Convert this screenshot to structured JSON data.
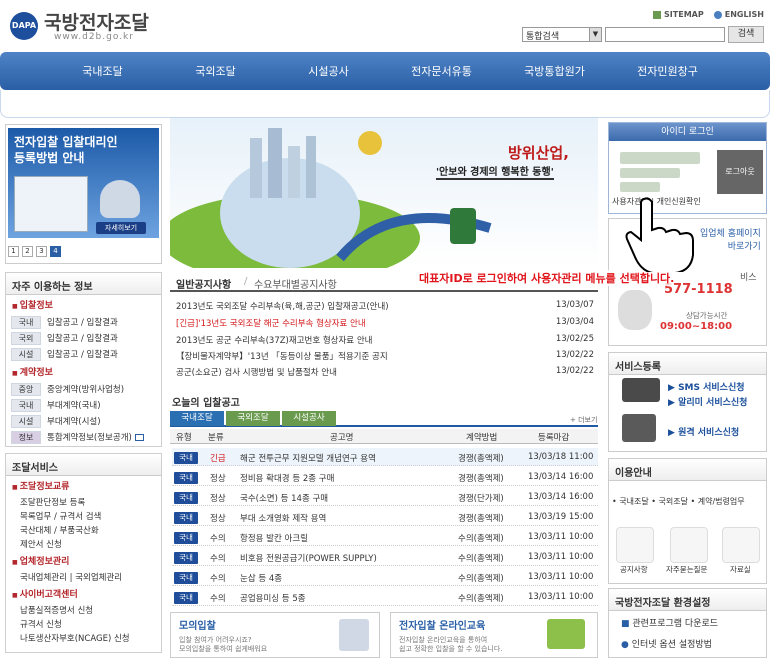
{
  "header": {
    "logo_mark": "DAPA",
    "site_name": "국방전자조달",
    "site_url": "www.d2b.go.kr",
    "sitemap": "SITEMAP",
    "english": "ENGLISH",
    "search_select": "통합검색",
    "search_button": "검색"
  },
  "nav": [
    "국내조달",
    "국외조달",
    "시설공사",
    "전자문서유통",
    "국방통합원가",
    "전자민원창구"
  ],
  "promo": {
    "title_line1": "전자입찰 입찰대리인",
    "title_line2": "등록방법 안내",
    "button": "자세히보기",
    "pages": [
      "1",
      "2",
      "3",
      "4"
    ],
    "active_page": "4"
  },
  "favorites": {
    "title": "자주 이용하는 정보",
    "groups": [
      {
        "name": "입찰정보",
        "rows": [
          {
            "tag": "국내",
            "text": "입찰공고 / 입찰결과"
          },
          {
            "tag": "국외",
            "text": "입찰공고 / 입찰결과"
          },
          {
            "tag": "시설",
            "text": "입찰공고 / 입찰결과"
          }
        ]
      },
      {
        "name": "계약정보",
        "rows": [
          {
            "tag": "중앙",
            "text": "중앙계약(방위사업청)"
          },
          {
            "tag": "국내",
            "text": "부대계약(국내)"
          },
          {
            "tag": "시설",
            "text": "부대계약(시설)"
          },
          {
            "tag": "정보",
            "text": "통합계약정보(정보공개)"
          }
        ]
      }
    ]
  },
  "services": {
    "title": "조달서비스",
    "groups": [
      {
        "name": "조달정보교류",
        "items": [
          "조달판단정보 등록",
          "목록업무 / 규격서 검색",
          "국산대체 / 부품국산화",
          "제안서 신청"
        ]
      },
      {
        "name": "업체정보관리",
        "items": [
          "국내업체관리 | 국외업체관리"
        ]
      },
      {
        "name": "사이버고객센터",
        "items": [
          "납품실적증명서 신청",
          "규격서 신청",
          "나토생산자부호(NCAGE) 신청"
        ]
      }
    ]
  },
  "banner": {
    "title": "방위산업,",
    "subtitle": "'안보와 경제의 행복한 동행'"
  },
  "notices": {
    "tab_active": "일반공지사항",
    "tab_other": "수요부대별공지사항",
    "items": [
      {
        "text": "2013년도 국외조달 수리부속(육,해,공군) 입찰재공고(안내)",
        "date": "13/03/07",
        "urgent": false
      },
      {
        "text": "[긴급]'13년도 국외조달 해군 수리부속 형상자료 안내",
        "date": "13/03/04",
        "urgent": true
      },
      {
        "text": "2013년도 공군 수리부속(37Z)재고번호 형상자료 안내",
        "date": "13/02/25",
        "urgent": false
      },
      {
        "text": "【장비물자계약부】'13년 「동등이상 물품」적용기준 공지",
        "date": "13/02/22",
        "urgent": false
      },
      {
        "text": "공군(소요군) 검사 시행방법 및 납품절차 안내",
        "date": "13/02/22",
        "urgent": false
      }
    ]
  },
  "bids": {
    "title": "오늘의 입찰공고",
    "tabs": [
      "국내조달",
      "국외조달",
      "시설공사"
    ],
    "more": "더보기",
    "headers": [
      "유형",
      "분류",
      "공고명",
      "계약방법",
      "등록마감"
    ],
    "rows": [
      {
        "type": "국내",
        "cat": "긴급",
        "name": "해군 전투근무 지원모델 개념연구 용역",
        "method": "경쟁(총액제)",
        "deadline": "13/03/18 11:00"
      },
      {
        "type": "국내",
        "cat": "정상",
        "name": "정비용 확대경 등 2종 구매",
        "method": "경쟁(총액제)",
        "deadline": "13/03/14 16:00"
      },
      {
        "type": "국내",
        "cat": "정상",
        "name": "국수(소면) 등 14종 구매",
        "method": "경쟁(단가제)",
        "deadline": "13/03/14 16:00"
      },
      {
        "type": "국내",
        "cat": "정상",
        "name": "부대 소개영화 제작 용역",
        "method": "경쟁(총액제)",
        "deadline": "13/03/19 15:00"
      },
      {
        "type": "국내",
        "cat": "수의",
        "name": "항정용 발칸 아크릴",
        "method": "수의(총액제)",
        "deadline": "13/03/11 10:00"
      },
      {
        "type": "국내",
        "cat": "수의",
        "name": "비호용 전원공급기(POWER SUPPLY)",
        "method": "수의(총액제)",
        "deadline": "13/03/11 10:00"
      },
      {
        "type": "국내",
        "cat": "수의",
        "name": "눈삽 등 4종",
        "method": "수의(총액제)",
        "deadline": "13/03/11 10:00"
      },
      {
        "type": "국내",
        "cat": "수의",
        "name": "공업용미싱 등 5종",
        "method": "수의(총액제)",
        "deadline": "13/03/11 10:00"
      }
    ]
  },
  "bottom": {
    "mock_title": "모의입찰",
    "mock_desc1": "입찰 참여가 어려우시죠?",
    "mock_desc2": "모의입찰을 통하여 쉽게배워요",
    "edu_title": "전자입찰 온라인교육",
    "edu_desc1": "전자입찰 온라인교육을 통하여",
    "edu_desc2": "쉽고 정확한 입찰을 할 수 있습니다."
  },
  "login": {
    "title": "아이디 로그인",
    "logout": "로그아웃",
    "links": "사용자관리 | 개인신원확인"
  },
  "overlay": "대표자ID로 로그인하여 사용자관리 메뉴를 선택합니다.",
  "help": {
    "link1": "입업체 홈페이지",
    "link2": "바로가기",
    "label": "비스",
    "phone": "577-1118",
    "hours_label": "상담가능시간",
    "hours": "09:00~18:00"
  },
  "register": {
    "title": "서비스등록",
    "items": [
      "SMS 서비스신청",
      "알리미 서비스신청",
      "원격 서비스신청"
    ]
  },
  "info": {
    "title": "이용안내",
    "links": "• 국내조달 • 국외조달 • 계약/법령업무",
    "icons": [
      "공지사항",
      "자주묻는질문",
      "자료실"
    ]
  },
  "env": {
    "title": "국방전자조달 환경설정",
    "items": [
      "관련프로그램 다운로드",
      "인터넷 옵션 설정방법"
    ]
  },
  "colors": {
    "nav": "#2a5fa6",
    "accent_red": "#e0141a",
    "badge": "#1f4d9a"
  }
}
